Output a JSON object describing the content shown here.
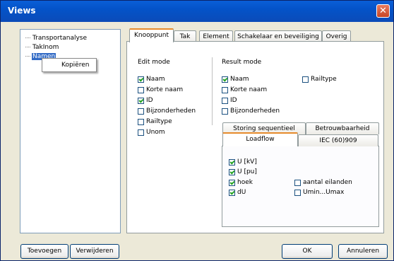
{
  "window": {
    "title": "Views",
    "close_glyph": "✕"
  },
  "tree": {
    "items": [
      {
        "label": "Transportanalyse",
        "selected": false
      },
      {
        "label": "TakInom",
        "selected": false
      },
      {
        "label": "Namen",
        "selected": true
      }
    ]
  },
  "context_menu": {
    "items": [
      "Kopiëren"
    ]
  },
  "tabs": [
    "Knooppunt",
    "Tak",
    "Element",
    "Schakelaar en beveiliging",
    "Overig"
  ],
  "active_tab": "Knooppunt",
  "edit_mode": {
    "label": "Edit mode",
    "options": [
      {
        "label": "Naam",
        "checked": true
      },
      {
        "label": "Korte naam",
        "checked": false
      },
      {
        "label": "ID",
        "checked": true
      },
      {
        "label": "Bijzonderheden",
        "checked": false
      },
      {
        "label": "Railtype",
        "checked": false
      },
      {
        "label": "Unom",
        "checked": false
      }
    ]
  },
  "result_mode": {
    "label": "Result mode",
    "options": [
      {
        "label": "Naam",
        "checked": true
      },
      {
        "label": "Korte naam",
        "checked": false
      },
      {
        "label": "ID",
        "checked": false
      },
      {
        "label": "Bijzonderheden",
        "checked": false
      },
      {
        "label": "Railtype",
        "checked": false
      }
    ]
  },
  "sub_tabs": {
    "row1": [
      "Storing sequentieel",
      "Betrouwbaarheid"
    ],
    "row2": [
      "Loadflow",
      "IEC (60)909"
    ],
    "active": "Loadflow"
  },
  "loadflow": {
    "left": [
      {
        "label": "U [kV]",
        "checked": true
      },
      {
        "label": "U [pu]",
        "checked": true
      },
      {
        "label": "hoek",
        "checked": true
      },
      {
        "label": "dU",
        "checked": true
      }
    ],
    "right": [
      {
        "label": "aantal eilanden",
        "checked": false
      },
      {
        "label": "Umin...Umax",
        "checked": false
      }
    ]
  },
  "buttons": {
    "add": "Toevoegen",
    "delete": "Verwijderen",
    "ok": "OK",
    "cancel": "Annuleren"
  }
}
